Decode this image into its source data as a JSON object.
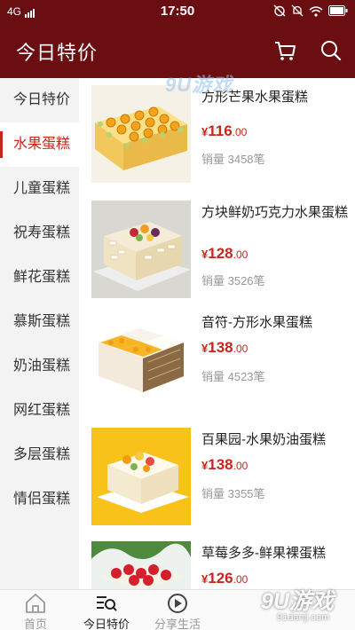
{
  "status_bar": {
    "network": "4G",
    "time": "17:50"
  },
  "app_bar": {
    "title": "今日特价"
  },
  "sidebar": {
    "items": [
      {
        "label": "今日特价",
        "active": false
      },
      {
        "label": "水果蛋糕",
        "active": true
      },
      {
        "label": "儿童蛋糕",
        "active": false
      },
      {
        "label": "祝寿蛋糕",
        "active": false
      },
      {
        "label": "鲜花蛋糕",
        "active": false
      },
      {
        "label": "慕斯蛋糕",
        "active": false
      },
      {
        "label": "奶油蛋糕",
        "active": false
      },
      {
        "label": "网红蛋糕",
        "active": false
      },
      {
        "label": "多层蛋糕",
        "active": false
      },
      {
        "label": "情侣蛋糕",
        "active": false
      }
    ]
  },
  "products": [
    {
      "name": "方形芒果水果蛋糕",
      "currency": "¥",
      "price_int": "116",
      "price_dec": ".00",
      "sales": "销量 3458笔"
    },
    {
      "name": "方块鲜奶巧克力水果蛋糕",
      "currency": "¥",
      "price_int": "128",
      "price_dec": ".00",
      "sales": "销量 3526笔"
    },
    {
      "name": "音符-方形水果蛋糕",
      "currency": "¥",
      "price_int": "138",
      "price_dec": ".00",
      "sales": "销量 4523笔"
    },
    {
      "name": "百果园-水果奶油蛋糕",
      "currency": "¥",
      "price_int": "138",
      "price_dec": ".00",
      "sales": "销量 3355笔"
    },
    {
      "name": "草莓多多-鲜果裸蛋糕",
      "currency": "¥",
      "price_int": "126",
      "price_dec": ".00",
      "sales": ""
    }
  ],
  "bottom_nav": {
    "tabs": [
      {
        "label": "首页",
        "icon": "home-icon",
        "active": false
      },
      {
        "label": "今日特价",
        "icon": "search-list-icon",
        "active": true
      },
      {
        "label": "分享生活",
        "icon": "play-icon",
        "active": false
      }
    ]
  },
  "watermark": {
    "top_text": "9U游戏",
    "text": "9U游戏",
    "url": "91danji.com"
  },
  "colors": {
    "brand": "#6b0e12",
    "accent": "#c8261a"
  }
}
